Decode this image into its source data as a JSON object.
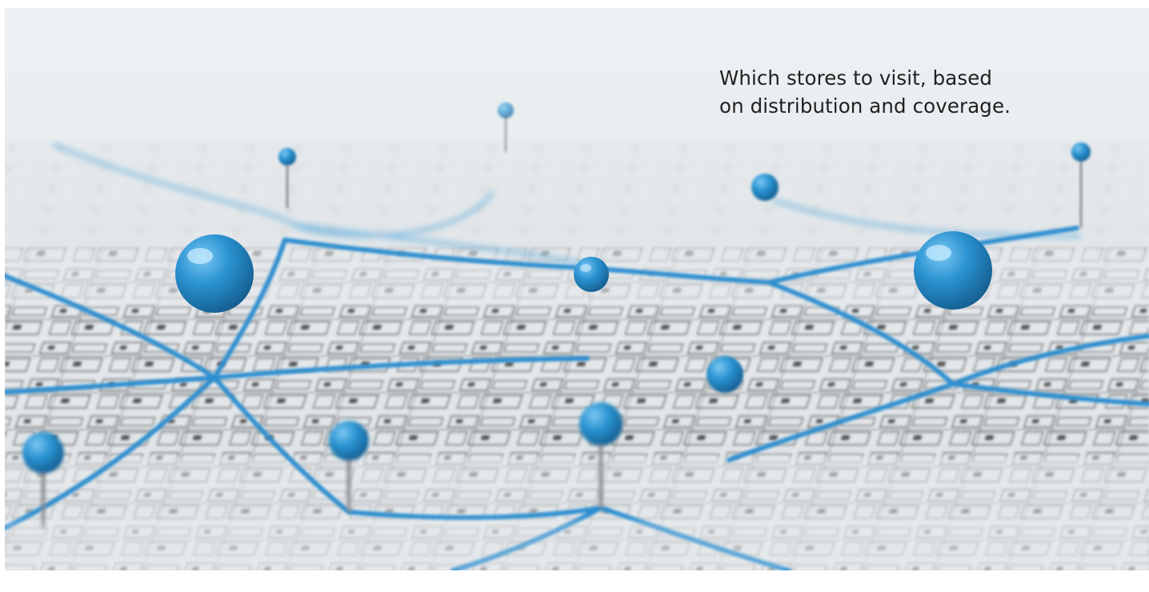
{
  "caption": {
    "line1": "Which stores to visit, based",
    "line2": "on distribution and coverage."
  },
  "colors": {
    "pin_blue": "#2a93d1",
    "string_blue": "#2f8fd0",
    "map_paper": "#e9ecee",
    "map_ink": "#3a3a3a",
    "caption_text": "#202020"
  },
  "photo": {
    "subject": "pushpin-icon"
  }
}
